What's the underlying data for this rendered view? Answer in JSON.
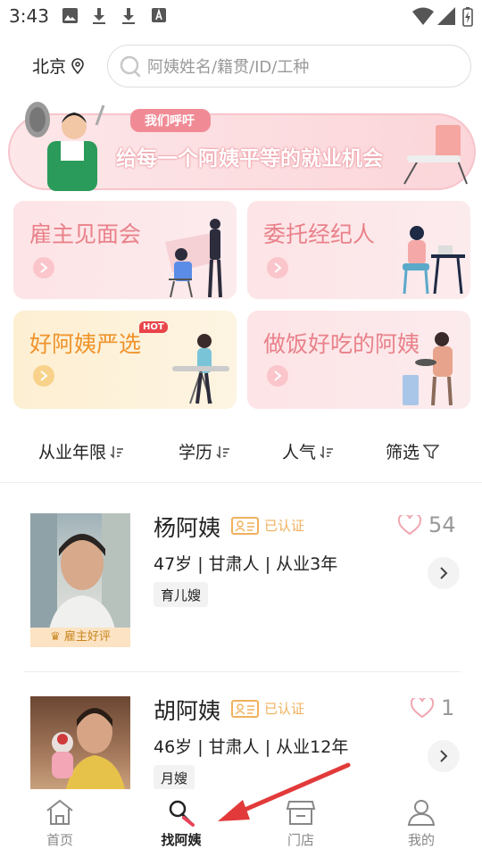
{
  "status": {
    "time": "3:43"
  },
  "header": {
    "location": "北京",
    "search_placeholder": "阿姨姓名/籍贯/ID/工种"
  },
  "banner": {
    "tag": "我们呼吁",
    "slogan": "给每一个阿姨平等的就业机会"
  },
  "cards": [
    {
      "title": "雇主见面会",
      "color": "#e9818a"
    },
    {
      "title": "委托经纪人",
      "color": "#e9818a"
    },
    {
      "title": "好阿姨严选",
      "color": "#f0932b",
      "badge": "HOT"
    },
    {
      "title": "做饭好吃的阿姨",
      "color": "#e9818a"
    }
  ],
  "filters": [
    {
      "label": "从业年限"
    },
    {
      "label": "学历"
    },
    {
      "label": "人气"
    },
    {
      "label": "筛选"
    }
  ],
  "listings": [
    {
      "name": "杨阿姨",
      "cert": "已认证",
      "likes": "54",
      "info": "47岁 | 甘肃人 | 从业3年",
      "tag": "育儿嫂",
      "badge": "雇主好评"
    },
    {
      "name": "胡阿姨",
      "cert": "已认证",
      "likes": "1",
      "info": "46岁 | 甘肃人 | 从业12年",
      "tag": "月嫂"
    }
  ],
  "tabbar": [
    {
      "label": "首页",
      "icon": "home-icon"
    },
    {
      "label": "找阿姨",
      "icon": "search-person-icon",
      "active": true
    },
    {
      "label": "门店",
      "icon": "store-icon"
    },
    {
      "label": "我的",
      "icon": "user-icon"
    }
  ]
}
